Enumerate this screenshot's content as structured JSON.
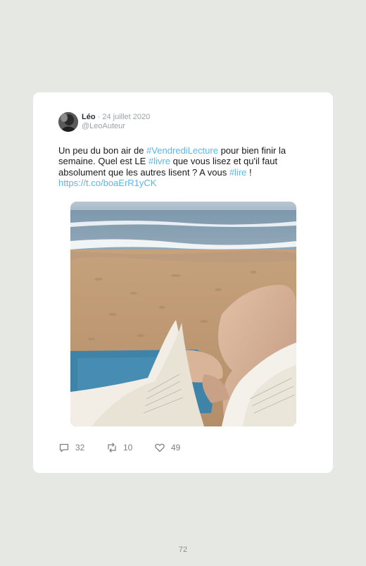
{
  "tweet": {
    "author": "Léo",
    "separator": "·",
    "date": "24 juillet 2020",
    "handle": "@LeoAuteur",
    "text_parts": {
      "p1": "Un peu du bon air de ",
      "hashtag1": "#VendrediLecture",
      "p2": " pour bien finir la semaine. Quel est LE ",
      "hashtag2": "#livre",
      "p3": " que vous lisez et qu'il faut absolument que les autres lisent ? A vous ",
      "hashtag3": "#lire",
      "p4": " !",
      "link": "https://t.co/boaErR1yCK"
    },
    "photo_icon": "beach-reading-photo",
    "actions": {
      "replies": "32",
      "retweets": "10",
      "likes": "49"
    }
  },
  "page_number": "72",
  "colors": {
    "background": "#e6e8e3",
    "card": "#ffffff",
    "hashtag": "#5bb7e6",
    "muted": "#9aa1a7"
  }
}
